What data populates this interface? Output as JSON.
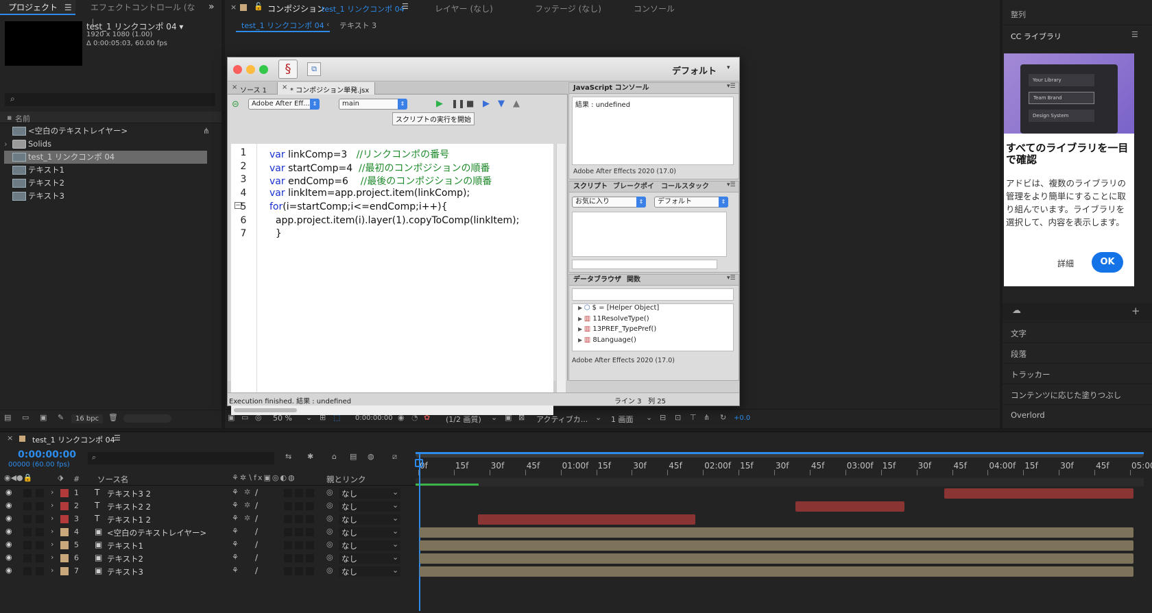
{
  "project": {
    "tab_label": "プロジェクト",
    "effect_tab": "エフェクトコントロール (なし",
    "comp_name": "test_1 リンクコンポ 04 ▾",
    "resolution": "1920 x 1080 (1.00)",
    "duration": "Δ 0:00:05:03, 60.00 fps",
    "search_placeholder": "",
    "column_name": "名前",
    "items": [
      {
        "label": "<空白のテキストレイヤー>",
        "type": "comp"
      },
      {
        "label": "Solids",
        "type": "folder"
      },
      {
        "label": "test_1 リンクコンポ 04",
        "type": "comp"
      },
      {
        "label": "テキスト1",
        "type": "comp"
      },
      {
        "label": "テキスト2",
        "type": "comp"
      },
      {
        "label": "テキスト3",
        "type": "comp"
      }
    ],
    "bpc": "16 bpc"
  },
  "viewer": {
    "tab_label": "コンポジション",
    "tab_comp": "test_1 リンクコンポ 04",
    "layer_tab": "レイヤー (なし)",
    "footage_tab": "フッテージ (なし)",
    "console_tab": "コンソール",
    "breadcrumb_1": "test_1 リンクコンポ 04",
    "breadcrumb_2": "テキスト 3",
    "zoom": "50 %",
    "timecode": "0:00:00:00",
    "quality": "(1/2 画質)",
    "camera": "アクティブカ...",
    "views": "1 画面",
    "exposure": "+0.0"
  },
  "estk": {
    "workspace": "デフォルト",
    "tab_source": "ソース 1",
    "tab_script": "* コンポジション単発.jsx",
    "target_app": "Adobe After Eff...",
    "target_engine": "main",
    "tooltip": "スクリプトの実行を開始",
    "code_lines": [
      {
        "num": "1",
        "code": "var linkComp=3   //リンクコンポの番号"
      },
      {
        "num": "2",
        "code": "var startComp=4  //最初のコンポジションの順番"
      },
      {
        "num": "3",
        "code": "var endComp=6    //最後のコンポジションの順番"
      },
      {
        "num": "4",
        "code": "var linkItem=app.project.item(linkComp);"
      },
      {
        "num": "5",
        "code": "for(i=startComp;i<=endComp;i++){"
      },
      {
        "num": "6",
        "code": "  app.project.item(i).layer(1).copyToComp(linkItem);"
      },
      {
        "num": "7",
        "code": "  }"
      }
    ],
    "console_title": "JavaScript コンソール",
    "console_output": "結果 : undefined",
    "console_footer": "Adobe After Effects 2020 (17.0)",
    "script_tabs": [
      "スクリプト",
      "ブレークポイ",
      "コールスタック"
    ],
    "scripts_dd1": "お気に入り",
    "scripts_dd2": "デフォルト",
    "browser_tabs": [
      "データブラウザ",
      "関数"
    ],
    "browser_items": [
      "$ = [Helper Object]",
      "11ResolveType()",
      "13PREF_TypePref()",
      "8Language()"
    ],
    "browser_footer": "Adobe After Effects 2020 (17.0)",
    "status_left": "Execution finished. 結果 : undefined",
    "status_right": "ライン 3   列 25"
  },
  "right_panel": {
    "align": "整列",
    "cc_title": "CC ライブラリ",
    "lib_items": [
      "Your Library",
      "Team Brand",
      "Design System"
    ],
    "headline": "すべてのライブラリを一目で確認",
    "body": "アドビは、複数のライブラリの管理をより簡単にすることに取り組んでいます。ライブラリを選択して、内容を表示します。",
    "details_btn": "詳細",
    "ok_btn": "OK",
    "panels": [
      "文字",
      "段落",
      "トラッカー",
      "コンテンツに応じた塗りつぶし",
      "Overlord"
    ]
  },
  "timeline": {
    "tab_label": "test_1 リンクコンポ 04",
    "timecode": "0:00:00:00",
    "frames": "00000 (60.00 fps)",
    "col_hash": "#",
    "col_source": "ソース名",
    "col_parent": "親とリンク",
    "ruler_labels": [
      "0f",
      "15f",
      "30f",
      "45f",
      "01:00f",
      "15f",
      "30f",
      "45f",
      "02:00f",
      "15f",
      "30f",
      "45f",
      "03:00f",
      "15f",
      "30f",
      "45f",
      "04:00f",
      "15f",
      "30f",
      "45f",
      "05:00f"
    ],
    "layers": [
      {
        "num": "1",
        "name": "テキスト3 2",
        "type": "text",
        "label_color": "#b23a3a",
        "parent": "なし",
        "in": 0.735,
        "out": 1.0,
        "bar_color": "#8a3434"
      },
      {
        "num": "2",
        "name": "テキスト2 2",
        "type": "text",
        "label_color": "#b23a3a",
        "parent": "なし",
        "in": 0.526,
        "out": 0.679,
        "bar_color": "#8a3434"
      },
      {
        "num": "3",
        "name": "テキスト1 2",
        "type": "text",
        "label_color": "#b23a3a",
        "parent": "なし",
        "in": 0.082,
        "out": 0.386,
        "bar_color": "#8a3434"
      },
      {
        "num": "4",
        "name": "<空白のテキストレイヤー>",
        "type": "comp",
        "label_color": "#c9a97b",
        "parent": "なし",
        "in": 0.0,
        "out": 1.0,
        "bar_color": "#7d725a"
      },
      {
        "num": "5",
        "name": "テキスト1",
        "type": "comp",
        "label_color": "#c9a97b",
        "parent": "なし",
        "in": 0.0,
        "out": 1.0,
        "bar_color": "#7d725a"
      },
      {
        "num": "6",
        "name": "テキスト2",
        "type": "comp",
        "label_color": "#c9a97b",
        "parent": "なし",
        "in": 0.0,
        "out": 1.0,
        "bar_color": "#7d725a"
      },
      {
        "num": "7",
        "name": "テキスト3",
        "type": "comp",
        "label_color": "#c9a97b",
        "parent": "なし",
        "in": 0.0,
        "out": 1.0,
        "bar_color": "#7d725a"
      }
    ]
  }
}
